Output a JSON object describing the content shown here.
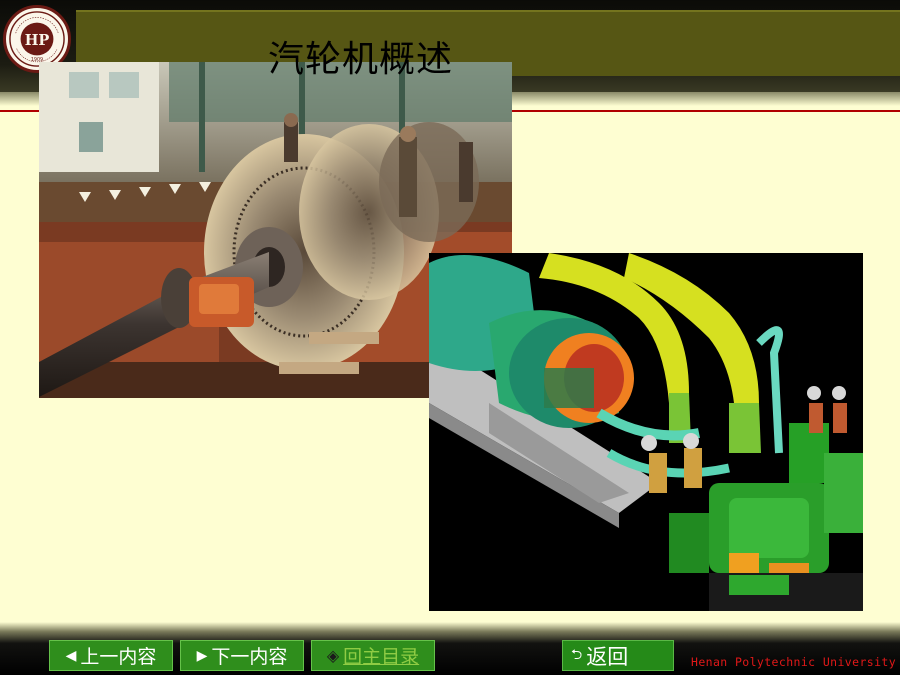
{
  "header": {
    "title": "汽轮机概述",
    "logo": {
      "icon": "university-seal-icon",
      "monogram": "HP",
      "year": "1909",
      "ring_text": "河南理工大学 HENAN POLYTECHNIC UNIVERSITY"
    }
  },
  "images": {
    "photo": "workshop-turbine-rotor-photo",
    "render": "turbine-3d-cad-render"
  },
  "nav": {
    "prev": {
      "glyph": "◀",
      "label": "上一内容"
    },
    "next": {
      "glyph": "▶",
      "label": "下一内容"
    },
    "main": {
      "glyph": "◈",
      "label": "回主目录"
    },
    "back": {
      "glyph": "⮌",
      "label": "返回"
    }
  },
  "footer": {
    "text": "Henan Polytechnic University"
  },
  "colors": {
    "background": "#fefed2",
    "title_bar": "#565614",
    "rule": "#b00000",
    "button": "#2f8e1c",
    "footer_text": "#e01818"
  }
}
